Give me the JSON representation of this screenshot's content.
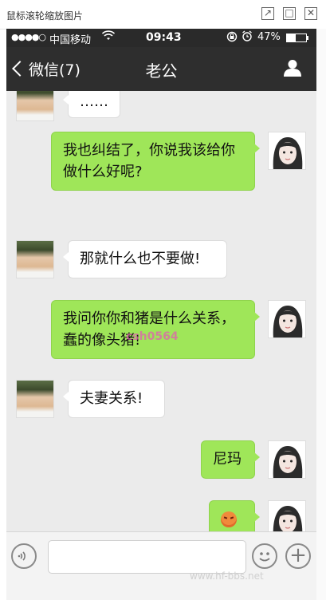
{
  "viewer": {
    "title": "鼠标滚轮缩放图片",
    "buttons": {
      "open_new": "↗",
      "maximize": "□",
      "close": "✕"
    }
  },
  "status_bar": {
    "signal": "●●●●○",
    "carrier": "中国移动",
    "wifi": "wifi-icon",
    "time": "09:43",
    "battery_percent": "47%",
    "battery_level": 0.47
  },
  "nav": {
    "back_label": "微信(7)",
    "title": "老公",
    "right_icon": "user-icon"
  },
  "messages": [
    {
      "sender": "him",
      "text": "……"
    },
    {
      "sender": "me",
      "text": "我也纠结了，你说我该给你做什么好呢?"
    },
    {
      "sender": "him",
      "text": "那就什么也不要做!"
    },
    {
      "sender": "me",
      "text": "我问你你和猪是什么关系，蠢的像头猪!"
    },
    {
      "sender": "him",
      "text": "夫妻关系!"
    },
    {
      "sender": "me",
      "text": "尼玛"
    },
    {
      "sender": "me",
      "text": "",
      "emoji": "angry-face-emoji"
    }
  ],
  "watermarks": {
    "top": "csh0564",
    "bottom": "www.hf-bbs.net"
  },
  "input": {
    "placeholder": "",
    "voice_icon": "voice-icon",
    "emoji_icon": "emoji-icon",
    "plus_icon": "plus-icon"
  },
  "colors": {
    "my_bubble": "#9fe659",
    "their_bubble": "#ffffff",
    "navbar": "#2e2e2e",
    "chat_bg": "#ebebeb"
  }
}
